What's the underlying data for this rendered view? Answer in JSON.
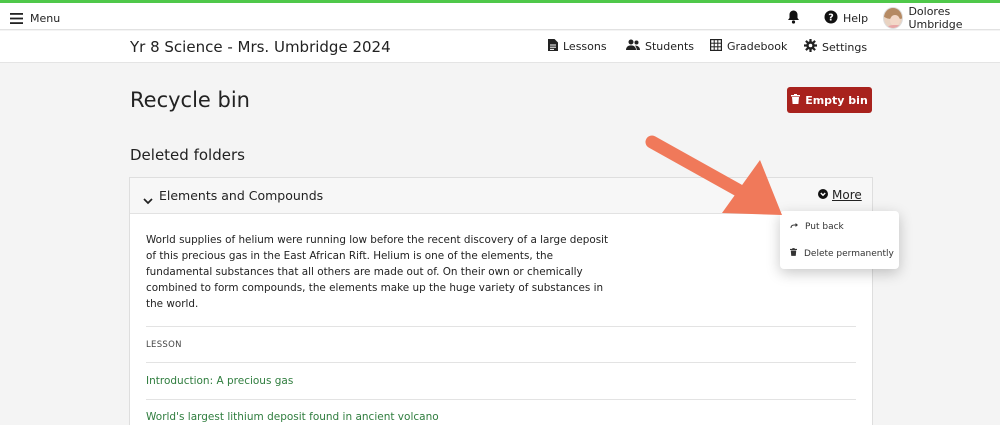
{
  "topbar": {
    "menu_label": "Menu",
    "help_label": "Help",
    "user_name": "Dolores Umbridge"
  },
  "course": {
    "title": "Yr 8 Science - Mrs. Umbridge 2024",
    "nav": {
      "lessons": "Lessons",
      "students": "Students",
      "gradebook": "Gradebook",
      "settings": "Settings"
    }
  },
  "page": {
    "title": "Recycle bin",
    "empty_bin_label": "Empty bin",
    "section_title": "Deleted folders"
  },
  "folder": {
    "name": "Elements and Compounds",
    "more_label": "More",
    "description": "World supplies of helium were running low before the recent discovery of a large deposit of this precious gas in the East African Rift. Helium is one of the elements, the fundamental substances that all others are made out of. On their own or chemically combined to form compounds, the elements make up the huge variety of substances in the world.",
    "column_header": "LESSON",
    "lessons": [
      "Introduction: A precious gas",
      "World's largest lithium deposit found in ancient volcano"
    ]
  },
  "dropdown": {
    "put_back": "Put back",
    "delete_permanently": "Delete permanently"
  },
  "colors": {
    "accent_green": "#4fc84a",
    "danger": "#a8221d",
    "link_green": "#2f7d3e",
    "annotation_arrow": "#f0795a"
  }
}
